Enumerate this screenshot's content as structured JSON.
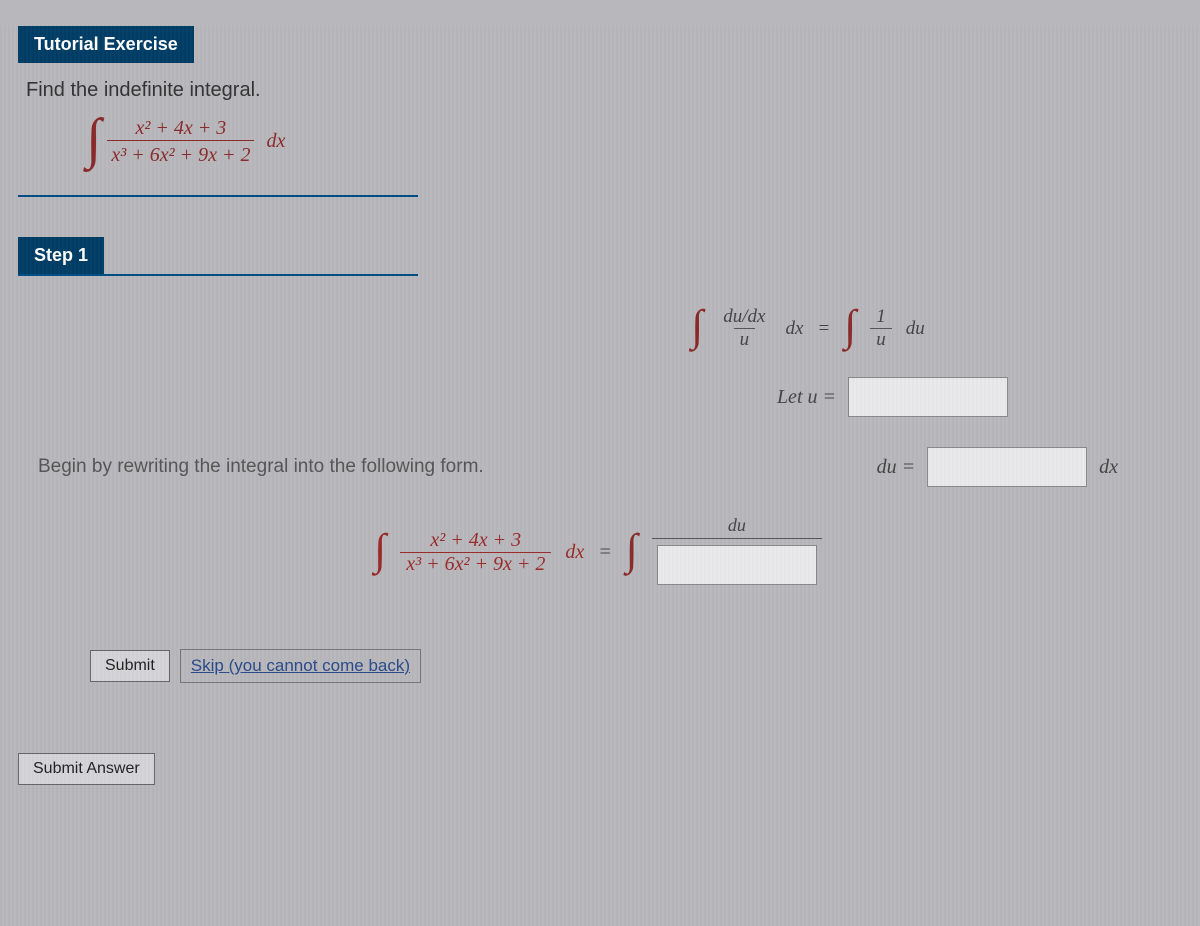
{
  "tutorial": {
    "header": "Tutorial Exercise",
    "prompt": "Find the indefinite integral.",
    "integral": {
      "numerator": "x² + 4x + 3",
      "denominator": "x³ + 6x² + 9x + 2",
      "dx": "dx"
    }
  },
  "step": {
    "header": "Step 1",
    "begin_text": "Begin by rewriting the integral into the following form.",
    "identity": {
      "left_num": "du/dx",
      "left_den": "u",
      "mid_dx": "dx",
      "eq": "=",
      "right_num": "1",
      "right_den": "u",
      "right_du": "du"
    },
    "let_u_label": "Let u =",
    "du_label": "du =",
    "du_trail": "dx",
    "final": {
      "left_num": "x² + 4x + 3",
      "left_den": "x³ + 6x² + 9x + 2",
      "left_dx": "dx",
      "eq": "=",
      "right_du": "du"
    }
  },
  "buttons": {
    "submit": "Submit",
    "skip": "Skip (you cannot come back)",
    "submit_answer": "Submit Answer"
  }
}
